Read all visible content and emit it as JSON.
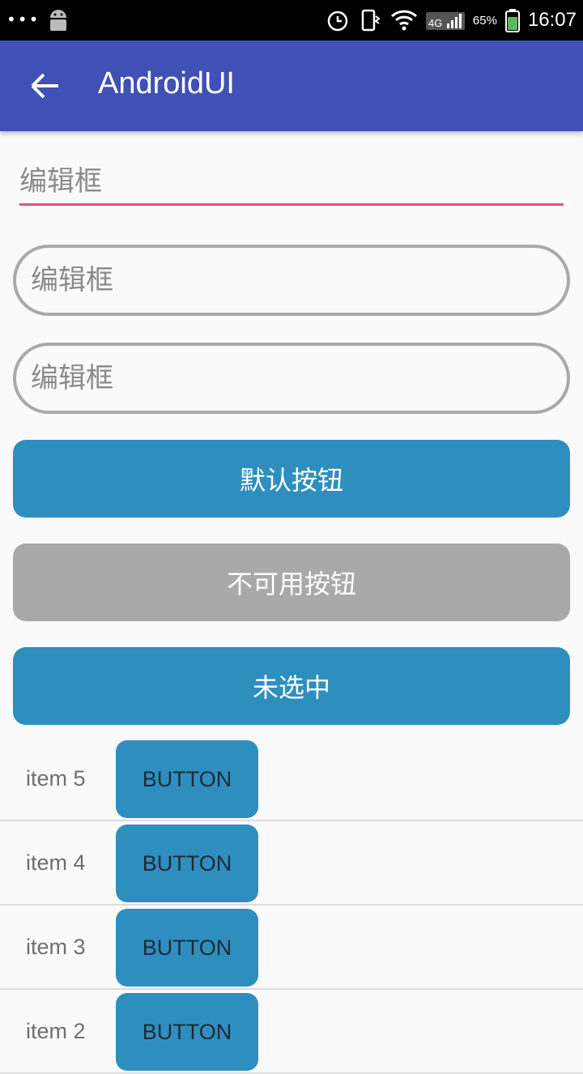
{
  "status_bar": {
    "time": "16:07",
    "battery": "65%",
    "network": "4G",
    "icons": [
      "more-dots-icon",
      "android-icon",
      "alarm-icon",
      "vibrate-icon",
      "wifi-icon",
      "signal-icon",
      "battery-icon"
    ]
  },
  "app_bar": {
    "title": "AndroidUI",
    "back_icon": "arrow-back-icon"
  },
  "edits": {
    "first_placeholder": "编辑框",
    "second_placeholder": "编辑框",
    "third_placeholder": "编辑框"
  },
  "buttons": {
    "default_label": "默认按钮",
    "disabled_label": "不可用按钮",
    "toggle_label": "未选中"
  },
  "list": {
    "items": [
      {
        "label": "item 5",
        "button": "BUTTON"
      },
      {
        "label": "item 4",
        "button": "BUTTON"
      },
      {
        "label": "item 3",
        "button": "BUTTON"
      },
      {
        "label": "item 2",
        "button": "BUTTON"
      }
    ]
  },
  "colors": {
    "app_bar": "#3f51b5",
    "accent": "#e84f85",
    "button": "#2e8fbf",
    "disabled": "#a9a9a9"
  }
}
